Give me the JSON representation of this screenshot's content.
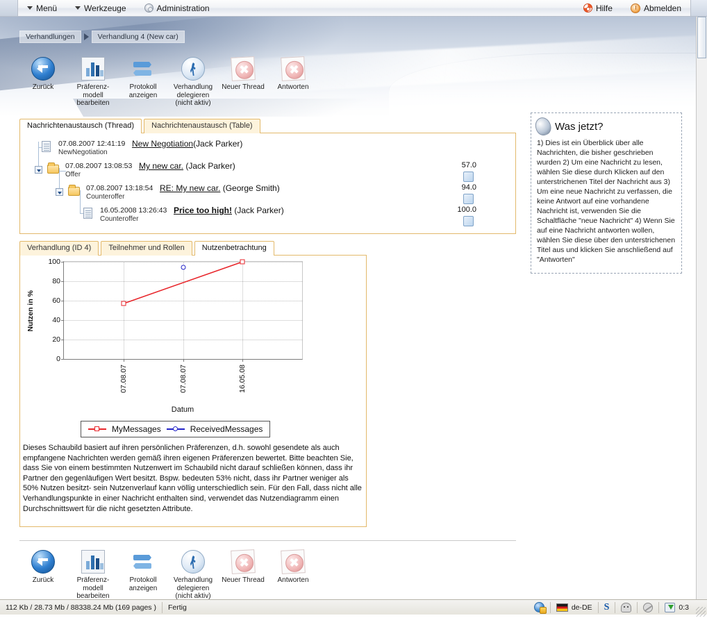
{
  "menubar": {
    "items": [
      {
        "label": "Menü",
        "icon": "chevron-down-icon"
      },
      {
        "label": "Werkzeuge",
        "icon": "chevron-down-icon"
      },
      {
        "label": "Administration",
        "icon": "gear-icon"
      }
    ],
    "right_items": [
      {
        "label": "Hilfe",
        "icon": "lifebuoy-icon"
      },
      {
        "label": "Abmelden",
        "icon": "power-icon"
      }
    ]
  },
  "breadcrumb": {
    "items": [
      "Verhandlungen",
      "Verhandlung 4 (New car)"
    ]
  },
  "toolbar": {
    "buttons": [
      {
        "label": "Zurück",
        "icon": "back-arrow-icon"
      },
      {
        "label": "Präferenz-\nmodell\nbearbeiten",
        "icon": "bar-chart-icon"
      },
      {
        "label": "Protokoll\nanzeigen",
        "icon": "refresh-arrows-icon"
      },
      {
        "label": "Verhandlung\ndelegieren\n(nicht aktiv)",
        "icon": "running-man-icon"
      },
      {
        "label": "Neuer Thread",
        "icon": "red-x-icon"
      },
      {
        "label": "Antworten",
        "icon": "red-x-icon"
      }
    ]
  },
  "message_tabs": {
    "tabs": [
      {
        "label": "Nachrichtenaustausch (Thread)",
        "active": true
      },
      {
        "label": "Nachrichtenaustausch (Table)",
        "active": false
      }
    ]
  },
  "thread": {
    "rows": [
      {
        "datetime": "07.08.2007 12:41:19",
        "title": "New Negotiation",
        "author": "(Jack Parker)",
        "type": "NewNegotiation",
        "value": "",
        "icon": "document-icon",
        "bold": false
      },
      {
        "datetime": "07.08.2007 13:08:53",
        "title": "My new car.",
        "author": "(Jack Parker)",
        "type": "Offer",
        "value": "57.0",
        "icon": "folder-icon",
        "bold": false
      },
      {
        "datetime": "07.08.2007 13:18:54",
        "title": "RE: My new car.",
        "author": "(George Smith)",
        "type": "Counteroffer",
        "value": "94.0",
        "icon": "folder-icon",
        "bold": false
      },
      {
        "datetime": "16.05.2008 13:26:43",
        "title": "Price too high!",
        "author": "(Jack Parker)",
        "type": "Counteroffer",
        "value": "100.0",
        "icon": "document-icon",
        "bold": true
      }
    ]
  },
  "help_panel": {
    "title": "Was jetzt?",
    "icon": "lightbulb-icon",
    "body": "1) Dies ist ein Überblick über alle Nachrichten, die bisher geschrieben wurden\n2) Um eine Nachricht zu lesen, wählen Sie diese durch Klicken auf den unterstrichenen Titel der Nachricht aus\n3) Um eine neue Nachricht zu verfassen, die keine Antwort auf eine vorhandene Nachricht ist, verwenden Sie die Schaltfläche \"neue Nachricht\"\n4) Wenn Sie auf eine Nachricht antworten wollen, wählen Sie diese über den unterstrichenen Titel aus und klicken Sie anschließend auf \"Antworten\""
  },
  "detail_tabs": {
    "tabs": [
      {
        "label": "Verhandlung (ID 4)",
        "active": false
      },
      {
        "label": "Teilnehmer und Rollen",
        "active": false
      },
      {
        "label": "Nutzenbetrachtung",
        "active": true
      }
    ]
  },
  "chart_data": {
    "type": "line",
    "title": "",
    "xlabel": "Datum",
    "ylabel": "Nutzen in %",
    "x": [
      "07.08.07",
      "07.08.07",
      "16.05.08"
    ],
    "xtick_labels": [
      "07.08.07",
      "07.08.07",
      "16.05.08"
    ],
    "ytick_labels": [
      "0",
      "20",
      "40",
      "60",
      "80",
      "100"
    ],
    "ylim": [
      0,
      100
    ],
    "grid": true,
    "legend_position": "bottom",
    "series": [
      {
        "name": "MyMessages",
        "color": "#e8262b",
        "marker": "square",
        "points": [
          {
            "x": "07.08.07",
            "y": 57
          },
          {
            "x": "16.05.08",
            "y": 100
          }
        ]
      },
      {
        "name": "ReceivedMessages",
        "color": "#2323c8",
        "marker": "circle",
        "points": [
          {
            "x": "07.08.07",
            "y": 94
          }
        ]
      }
    ]
  },
  "chart_description": "Dieses Schaubild basiert auf ihren persönlichen Präferenzen, d.h. sowohl gesendete als auch empfangene Nachrichten werden gemäß ihren eigenen Präferenzen bewertet.\nBitte beachten Sie, dass Sie von einem bestimmten Nutzenwert im Schaubild nicht darauf schließen können, dass ihr Partner den gegenläufigen Wert besitzt. Bspw. bedeuten 53% nicht, dass ihr Partner weniger als 50% Nutzen besitzt- sein Nutzenverlauf kann völlig unterschiedlich sein.\nFür den Fall, dass nicht alle Verhandlungspunkte in einer Nachricht enthalten sind, verwendet das Nutzendiagramm einen Durchschnittswert für die nicht gesetzten Attribute.",
  "statusbar": {
    "memory": "112 Kb / 28.73 Mb / 88338.24 Mb (169 pages )",
    "status": "Fertig",
    "locale": "de-DE",
    "time": "0:3",
    "icons": [
      "globe-icon",
      "german-flag-icon",
      "skype-icon",
      "robot-icon",
      "clock-icon",
      "download-icon"
    ]
  },
  "colors": {
    "accent_border": "#e3b96b",
    "tab_inactive": "#fdf3dc",
    "series_red": "#e8262b",
    "series_blue": "#2323c8"
  }
}
